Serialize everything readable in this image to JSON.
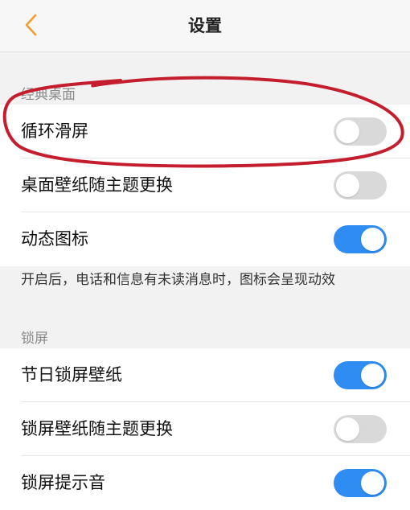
{
  "header": {
    "title": "设置",
    "back_icon": "chevron-left-icon",
    "accent_color": "#f0a030"
  },
  "classic_desktop": {
    "section_title": "经典桌面",
    "items": [
      {
        "label": "循环滑屏",
        "enabled": false
      },
      {
        "label": "桌面壁纸随主题更换",
        "enabled": false
      },
      {
        "label": "动态图标",
        "enabled": true
      }
    ],
    "hint": "开启后，电话和信息有未读消息时，图标会呈现动效"
  },
  "lock_screen": {
    "section_title": "锁屏",
    "items": [
      {
        "label": "节日锁屏壁纸",
        "enabled": true
      },
      {
        "label": "锁屏壁纸随主题更换",
        "enabled": false
      },
      {
        "label": "锁屏提示音",
        "enabled": true
      }
    ]
  },
  "colors": {
    "toggle_on": "#2f8cf2",
    "toggle_off": "#d9d9d9",
    "annotation_circle": "#c41e2e"
  }
}
